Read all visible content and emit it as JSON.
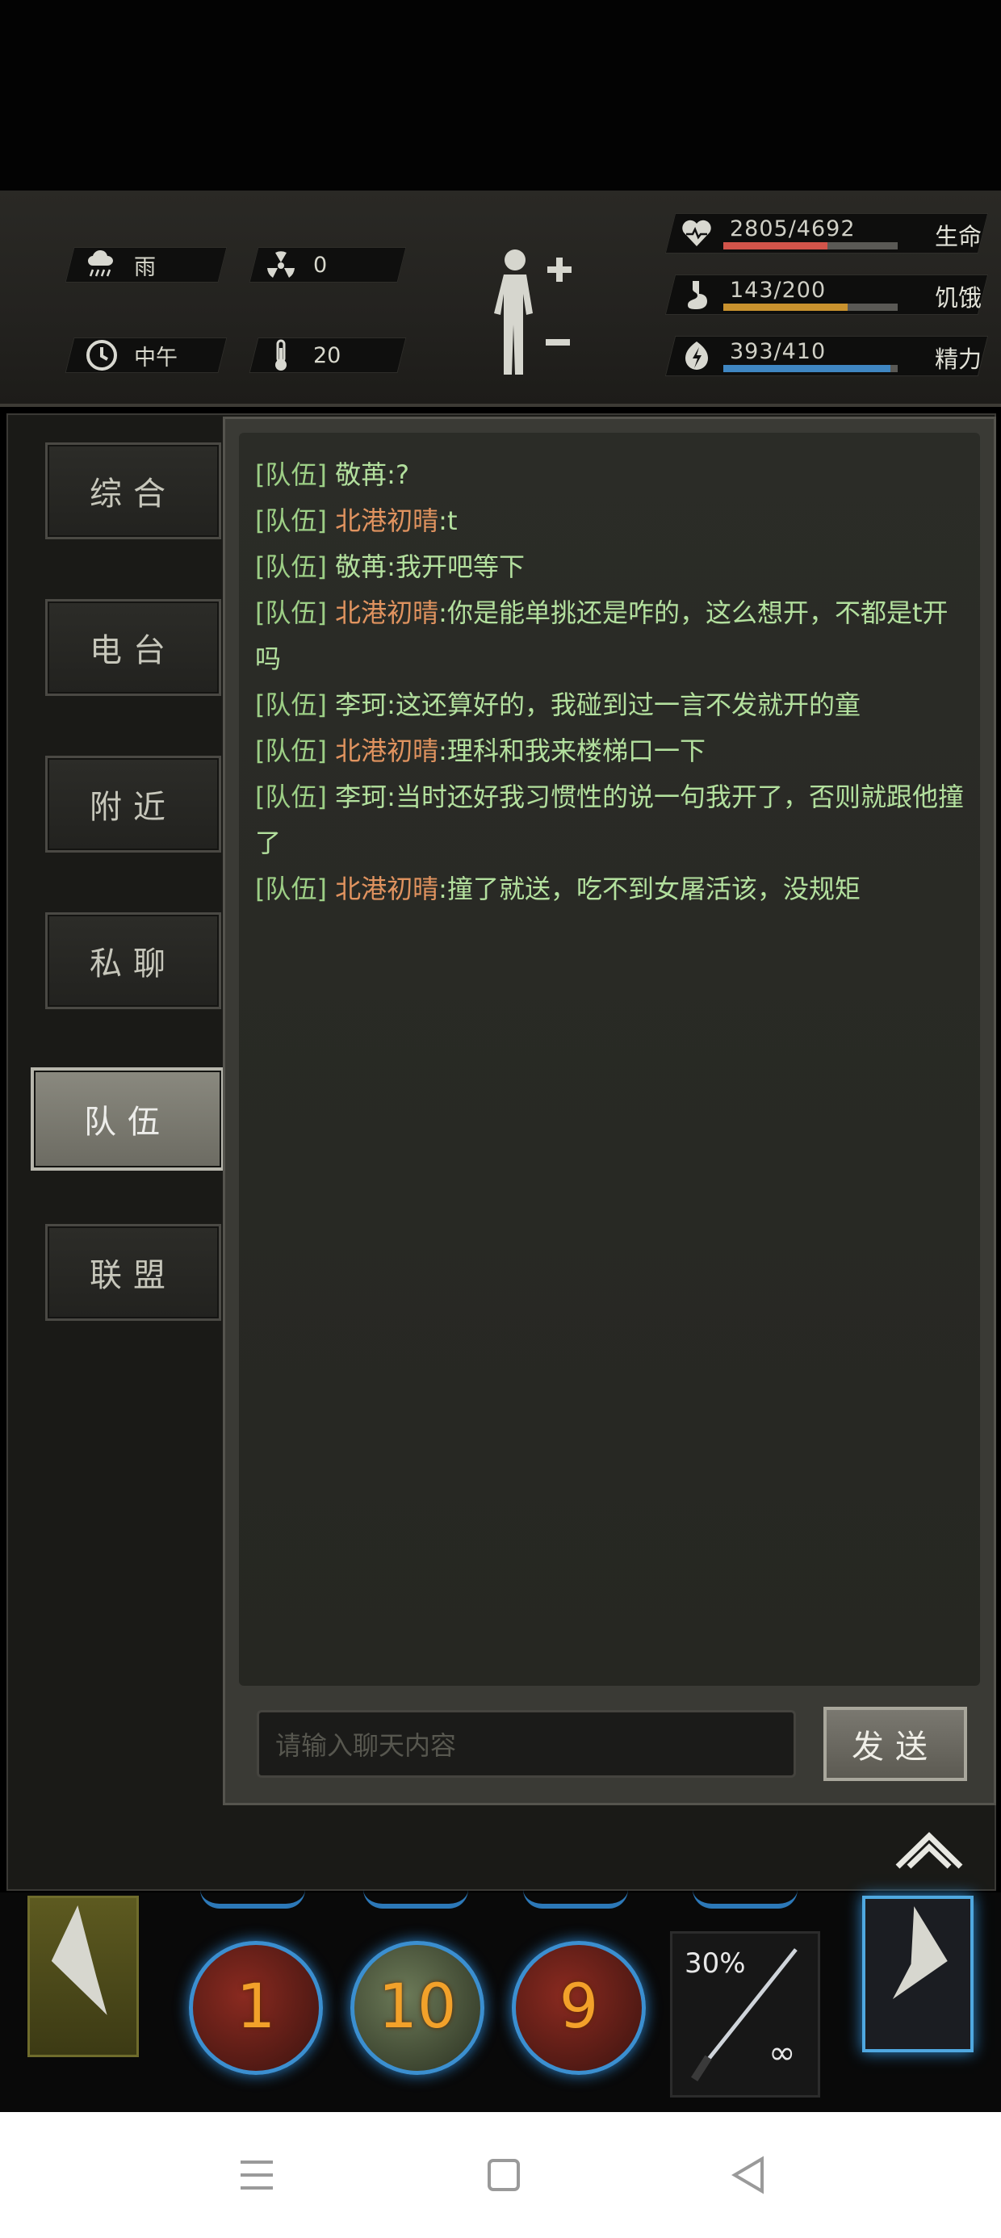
{
  "header": {
    "weather": {
      "icon": "rain-cloud-icon",
      "label": "雨"
    },
    "radiation": {
      "icon": "radiation-icon",
      "value": "0"
    },
    "time": {
      "icon": "clock-icon",
      "label": "中午"
    },
    "temperature": {
      "icon": "thermometer-icon",
      "value": "20"
    },
    "stats": [
      {
        "icon": "heart-icon",
        "text": "2805/4692",
        "label": "生命",
        "fill": 0.598,
        "color": "#d1544a"
      },
      {
        "icon": "stomach-icon",
        "text": "143/200",
        "label": "饥饿",
        "fill": 0.715,
        "color": "#c9922e"
      },
      {
        "icon": "energy-icon",
        "text": "393/410",
        "label": "精力",
        "fill": 0.958,
        "color": "#3f86c2"
      }
    ]
  },
  "tabs": [
    {
      "label": "综合",
      "active": false
    },
    {
      "label": "电台",
      "active": false
    },
    {
      "label": "附近",
      "active": false
    },
    {
      "label": "私聊",
      "active": false
    },
    {
      "label": "队伍",
      "active": true
    },
    {
      "label": "联盟",
      "active": false
    }
  ],
  "messages": [
    {
      "channel": "[队伍]",
      "name": "敬苒",
      "name_color": "green",
      "text": ":?"
    },
    {
      "channel": "[队伍]",
      "name": "北港初晴",
      "name_color": "orange",
      "text": ":t"
    },
    {
      "channel": "[队伍]",
      "name": "敬苒",
      "name_color": "green",
      "text": ":我开吧等下"
    },
    {
      "channel": "[队伍]",
      "name": "北港初晴",
      "name_color": "orange",
      "text": ":你是能单挑还是咋的，这么想开，不都是t开吗"
    },
    {
      "channel": "[队伍]",
      "name": "李珂",
      "name_color": "green",
      "text": ":这还算好的，我碰到过一言不发就开的童"
    },
    {
      "channel": "[队伍]",
      "name": "北港初晴",
      "name_color": "orange",
      "text": ":理科和我来楼梯口一下"
    },
    {
      "channel": "[队伍]",
      "name": "李珂",
      "name_color": "green",
      "text": ":当时还好我习惯性的说一句我开了，否则就跟他撞了"
    },
    {
      "channel": "[队伍]",
      "name": "北港初晴",
      "name_color": "orange",
      "text": ":撞了就送，吃不到女屠活该，没规矩"
    }
  ],
  "input": {
    "placeholder": "请输入聊天内容",
    "send_label": "发送"
  },
  "skills": [
    {
      "icon": "axe-skill-icon",
      "count": "1"
    },
    {
      "icon": "heal-skill-icon",
      "count": "10"
    },
    {
      "icon": "slash-skill-icon",
      "count": "9"
    }
  ],
  "weapon": {
    "icon": "katana-icon",
    "percent": "30%",
    "ammo": "∞"
  }
}
